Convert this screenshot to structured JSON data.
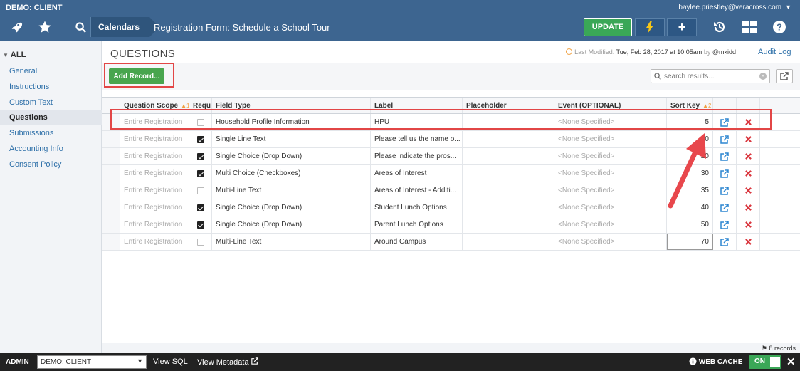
{
  "header": {
    "client": "DEMO: CLIENT",
    "user": "baylee.priestley@veracross.com",
    "breadcrumb_parent": "Calendars",
    "breadcrumb_current": "Registration Form: Schedule a School Tour",
    "update_label": "UPDATE"
  },
  "sidebar": {
    "all_label": "ALL",
    "items": [
      {
        "label": "General"
      },
      {
        "label": "Instructions"
      },
      {
        "label": "Custom Text"
      },
      {
        "label": "Questions"
      },
      {
        "label": "Submissions"
      },
      {
        "label": "Accounting Info"
      },
      {
        "label": "Consent Policy"
      }
    ]
  },
  "main": {
    "title": "QUESTIONS",
    "last_modified_prefix": "Last Modified:",
    "last_modified_value": "Tue, Feb 28, 2017 at 10:05am",
    "last_modified_by": "by",
    "last_modified_user": "@mkidd",
    "audit_log": "Audit Log",
    "add_record": "Add Record...",
    "search_placeholder": "search results..."
  },
  "table": {
    "headers": {
      "scope": "Question Scope",
      "scope_sort": "▲1",
      "required": "Required",
      "field_type": "Field Type",
      "label": "Label",
      "placeholder": "Placeholder",
      "event": "Event (OPTIONAL)",
      "sort_key": "Sort Key",
      "sort_key_sort": "▲2"
    },
    "rows": [
      {
        "scope": "Entire Registration",
        "required": false,
        "field_type": "Household Profile Information",
        "label": "HPU",
        "placeholder": "",
        "event": "<None Specified>",
        "sort_key": "5"
      },
      {
        "scope": "Entire Registration",
        "required": true,
        "field_type": "Single Line Text",
        "label": "Please tell us the name o...",
        "placeholder": "",
        "event": "<None Specified>",
        "sort_key": "10"
      },
      {
        "scope": "Entire Registration",
        "required": true,
        "field_type": "Single Choice (Drop Down)",
        "label": "Please indicate the pros...",
        "placeholder": "",
        "event": "<None Specified>",
        "sort_key": "20"
      },
      {
        "scope": "Entire Registration",
        "required": true,
        "field_type": "Multi Choice (Checkboxes)",
        "label": "Areas of Interest",
        "placeholder": "",
        "event": "<None Specified>",
        "sort_key": "30"
      },
      {
        "scope": "Entire Registration",
        "required": false,
        "field_type": "Multi-Line Text",
        "label": "Areas of Interest - Additi...",
        "placeholder": "",
        "event": "<None Specified>",
        "sort_key": "35"
      },
      {
        "scope": "Entire Registration",
        "required": true,
        "field_type": "Single Choice (Drop Down)",
        "label": "Student Lunch Options",
        "placeholder": "",
        "event": "<None Specified>",
        "sort_key": "40"
      },
      {
        "scope": "Entire Registration",
        "required": true,
        "field_type": "Single Choice (Drop Down)",
        "label": "Parent Lunch Options",
        "placeholder": "",
        "event": "<None Specified>",
        "sort_key": "50"
      },
      {
        "scope": "Entire Registration",
        "required": false,
        "field_type": "Multi-Line Text",
        "label": "Around Campus",
        "placeholder": "",
        "event": "<None Specified>",
        "sort_key": "70"
      }
    ],
    "records_count": "8 records"
  },
  "footer": {
    "admin": "ADMIN",
    "client_select": "DEMO: CLIENT",
    "view_sql": "View SQL",
    "view_metadata": "View Metadata",
    "web_cache": "WEB CACHE",
    "toggle": "ON"
  },
  "colors": {
    "topbar": "#3d6590",
    "accent_green": "#3aa757",
    "link_blue": "#2d6fa8",
    "delete_red": "#d9363e",
    "highlight_red": "#e24646"
  }
}
